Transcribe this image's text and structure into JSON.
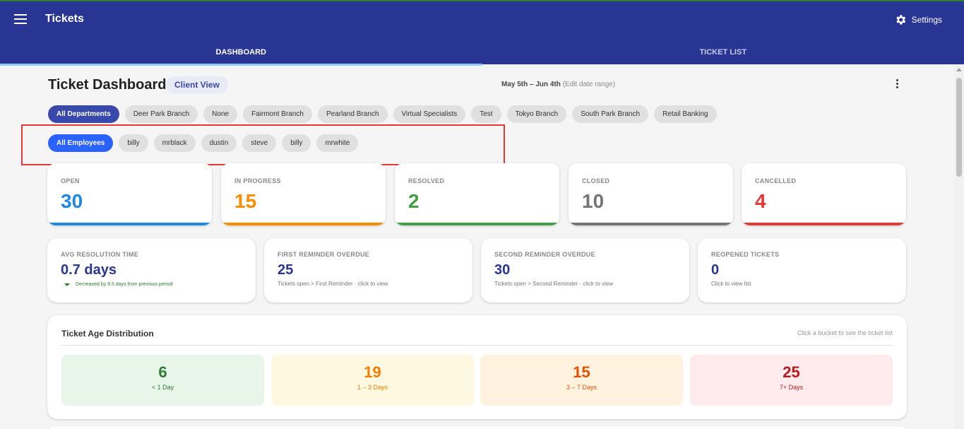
{
  "app": {
    "title": "Tickets",
    "settings_label": "Settings"
  },
  "tabs": [
    {
      "label": "DASHBOARD",
      "active": true
    },
    {
      "label": "TICKET LIST",
      "active": false
    }
  ],
  "header": {
    "title": "Ticket Dashboard",
    "client_view_label": "Client View",
    "date_range": "May 5th – Jun 4th",
    "edit_date_range": "(Edit date range)"
  },
  "departments": [
    "All Departments",
    "Deer Park Branch",
    "None",
    "Fairmont Branch",
    "Pearland Branch",
    "Virtual Specialists",
    "Test",
    "Tokyo Branch",
    "South Park Branch",
    "Retail Banking"
  ],
  "employees": [
    "All Employees",
    "billy",
    "mrblack",
    "dustin",
    "steve",
    "billy",
    "mrwhite"
  ],
  "status_cards": [
    {
      "label": "OPEN",
      "value": "30",
      "color": "#1e88e5"
    },
    {
      "label": "IN PROGRESS",
      "value": "15",
      "color": "#fb8c00"
    },
    {
      "label": "RESOLVED",
      "value": "2",
      "color": "#43a047"
    },
    {
      "label": "CLOSED",
      "value": "10",
      "color": "#757575"
    },
    {
      "label": "CANCELLED",
      "value": "4",
      "color": "#e53935"
    }
  ],
  "metrics": [
    {
      "label": "AVG RESOLUTION TIME",
      "value": "0.7 days",
      "trend": "Decreased by 8.5 days from previous period"
    },
    {
      "label": "FIRST REMINDER OVERDUE",
      "value": "25",
      "sub": "Tickets open > First Reminder · click to view"
    },
    {
      "label": "SECOND REMINDER OVERDUE",
      "value": "30",
      "sub": "Tickets open > Second Reminder · click to view"
    },
    {
      "label": "REOPENED TICKETS",
      "value": "0",
      "sub": "Click to view list"
    }
  ],
  "age_distribution": {
    "title": "Ticket Age Distribution",
    "hint": "Click a bucket to see the ticket list",
    "buckets": [
      {
        "count": "6",
        "range": "< 1 Day",
        "bg": "#e8f5e9",
        "color": "#2e7d32"
      },
      {
        "count": "19",
        "range": "1 – 3 Days",
        "bg": "#fff8e1",
        "color": "#f57c00"
      },
      {
        "count": "15",
        "range": "3 – 7 Days",
        "bg": "#fff3e0",
        "color": "#e65100"
      },
      {
        "count": "25",
        "range": "7+ Days",
        "bg": "#ffebee",
        "color": "#b71c1c"
      }
    ]
  }
}
